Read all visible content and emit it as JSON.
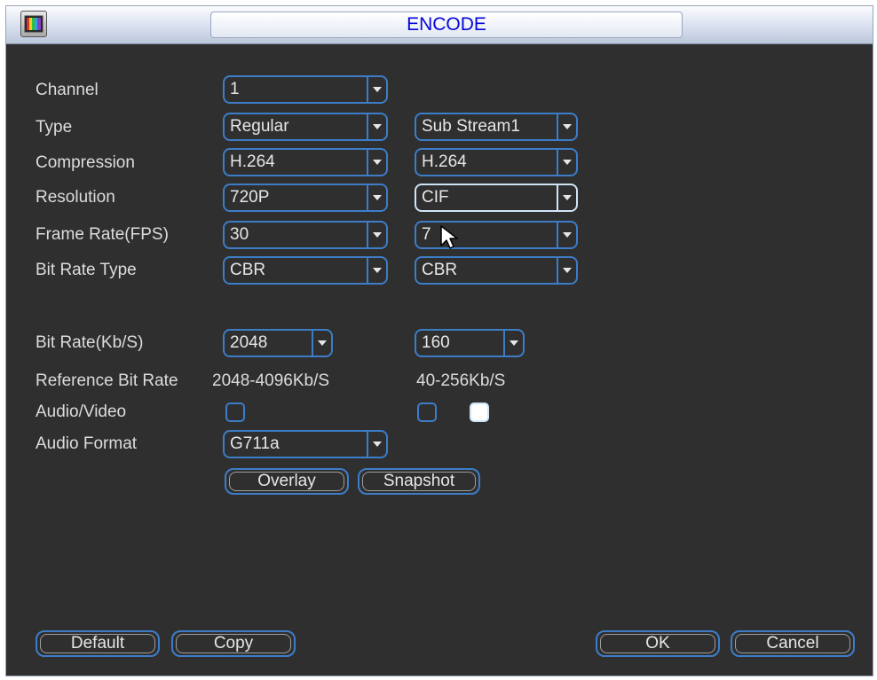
{
  "window": {
    "title": "ENCODE"
  },
  "labels": {
    "channel": "Channel",
    "type": "Type",
    "compression": "Compression",
    "resolution": "Resolution",
    "frame_rate": "Frame Rate(FPS)",
    "bit_rate_type": "Bit Rate Type",
    "bit_rate": "Bit Rate(Kb/S)",
    "reference_bit_rate": "Reference Bit Rate",
    "audio_video": "Audio/Video",
    "audio_format": "Audio Format"
  },
  "main_stream": {
    "channel": "1",
    "type": "Regular",
    "compression": "H.264",
    "resolution": "720P",
    "frame_rate": "30",
    "bit_rate_type": "CBR",
    "bit_rate": "2048",
    "reference_bit_rate": "2048-4096Kb/S",
    "audio_format": "G711a",
    "video_enabled": false
  },
  "sub_stream": {
    "type": "Sub Stream1",
    "compression": "H.264",
    "resolution": "CIF",
    "frame_rate": "7",
    "bit_rate_type": "CBR",
    "bit_rate": "160",
    "reference_bit_rate": "40-256Kb/S",
    "video_enabled": false,
    "audio_enabled": true
  },
  "buttons": {
    "overlay": "Overlay",
    "snapshot": "Snapshot",
    "default": "Default",
    "copy": "Copy",
    "ok": "OK",
    "cancel": "Cancel"
  },
  "colors": {
    "title_text": "#0606d8",
    "panel_bg": "#2f2f2f",
    "control_border": "#3d7dc8",
    "label_text": "#dcdcdc"
  }
}
